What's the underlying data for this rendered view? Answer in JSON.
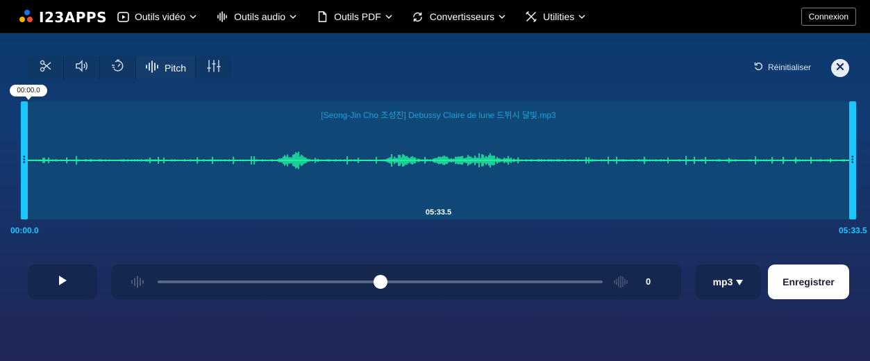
{
  "app": {
    "logo_text": "I23APPS",
    "colors": {
      "accent": "#19c8ff",
      "wave": "#1ef0a0",
      "dot_blue": "#1a73e8",
      "dot_red": "#f0463c",
      "dot_yellow": "#f7b500"
    }
  },
  "nav": [
    {
      "label": "Outils vidéo",
      "icon": "video-play-icon"
    },
    {
      "label": "Outils audio",
      "icon": "audio-wave-icon"
    },
    {
      "label": "Outils PDF",
      "icon": "document-icon"
    },
    {
      "label": "Convertisseurs",
      "icon": "convert-icon"
    },
    {
      "label": "Utilities",
      "icon": "tools-icon"
    }
  ],
  "login_label": "Connexion",
  "toolbar": {
    "tools": [
      {
        "name": "trim",
        "icon": "scissors-icon"
      },
      {
        "name": "volume",
        "icon": "speaker-icon"
      },
      {
        "name": "speed",
        "icon": "speed-icon"
      },
      {
        "name": "pitch",
        "icon": "pitch-wave-icon",
        "label": "Pitch",
        "active": true
      },
      {
        "name": "equalizer",
        "icon": "equalizer-icon"
      }
    ],
    "reset_label": "Réinitialiser"
  },
  "waveform": {
    "filename": "[Seong-Jin Cho 조성진] Debussy Claire de lune 드뷔시 달빛.mp3",
    "cursor_time": "00:00.0",
    "center_time": "05:33.5",
    "start_time": "00:00.0",
    "end_time": "05:33.5"
  },
  "controls": {
    "pitch_value": "0",
    "pitch_level": 0.5,
    "format": "mp3",
    "save_label": "Enregistrer"
  }
}
